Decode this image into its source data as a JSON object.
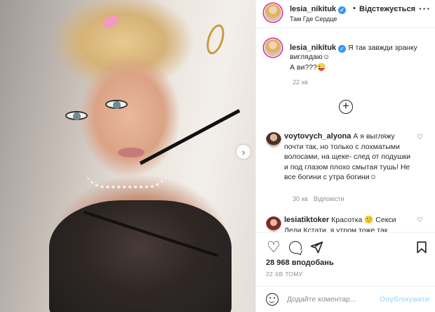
{
  "post": {
    "author": "lesia_nikituk",
    "follow_separator": "•",
    "follow_label": "Відстежується",
    "location": "Там Где Сердце",
    "more_label": "···",
    "caption_line1": "Я так завжди зранку",
    "caption_line2": "виглядаю☺",
    "caption_line3": "А ви???😜",
    "caption_time": "22 хв",
    "add_more": "+",
    "next_label": "›",
    "verified_mark": "✓"
  },
  "comments": [
    {
      "author": "voytovych_alyona",
      "text": "А я выгляжу почти так, но только с лохматыми волосами, на щеке- след от подушки и под глазом плохо смытая тушь! Не все богини с утра богини☺",
      "time": "30 хв",
      "replies": "Відповісти",
      "heart": "♡"
    },
    {
      "author": "lesiatiktoker",
      "text": "Красотка 🙂 Секси Леди Кстати, я утром тоже так",
      "heart": "♡"
    }
  ],
  "stats": {
    "likes": "28 968 вподобань",
    "ago": "22 ХВ ТОМУ"
  },
  "composer": {
    "placeholder": "Додайте коментар...",
    "publish_label": "Опублікувати"
  },
  "colors": {
    "verified": "#3897f0",
    "publish": "#b2dffc",
    "muted": "#8e8e8e"
  }
}
